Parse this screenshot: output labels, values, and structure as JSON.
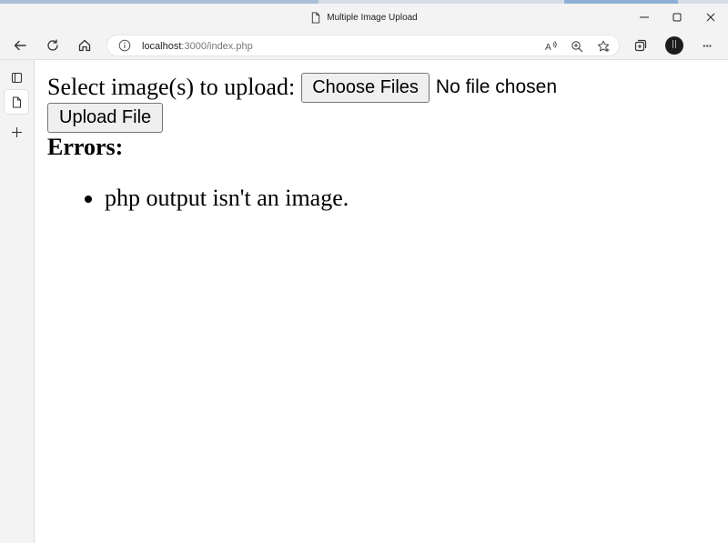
{
  "window": {
    "title": "Multiple Image Upload",
    "controls": {
      "minimize": "minimize",
      "maximize": "maximize",
      "close": "close"
    }
  },
  "toolbar": {
    "url_host": "localhost",
    "url_path": ":3000/index.php",
    "more_label": "···"
  },
  "page": {
    "select_label": "Select image(s) to upload:",
    "choose_button": "Choose Files",
    "file_status": "No file chosen",
    "upload_button": "Upload File",
    "errors_heading": "Errors:",
    "errors": [
      "php output isn't an image."
    ]
  },
  "icons": {
    "back": "back-arrow-icon",
    "refresh": "refresh-icon",
    "home": "home-icon",
    "info": "info-icon",
    "read_aloud": "read-aloud-icon",
    "zoom": "zoom-icon",
    "favorite": "favorite-star-icon",
    "collections": "collections-icon",
    "profile": "profile-avatar",
    "tab_actions": "tab-actions-icon",
    "page_tab": "page-tab-icon",
    "new_tab": "plus-icon"
  }
}
